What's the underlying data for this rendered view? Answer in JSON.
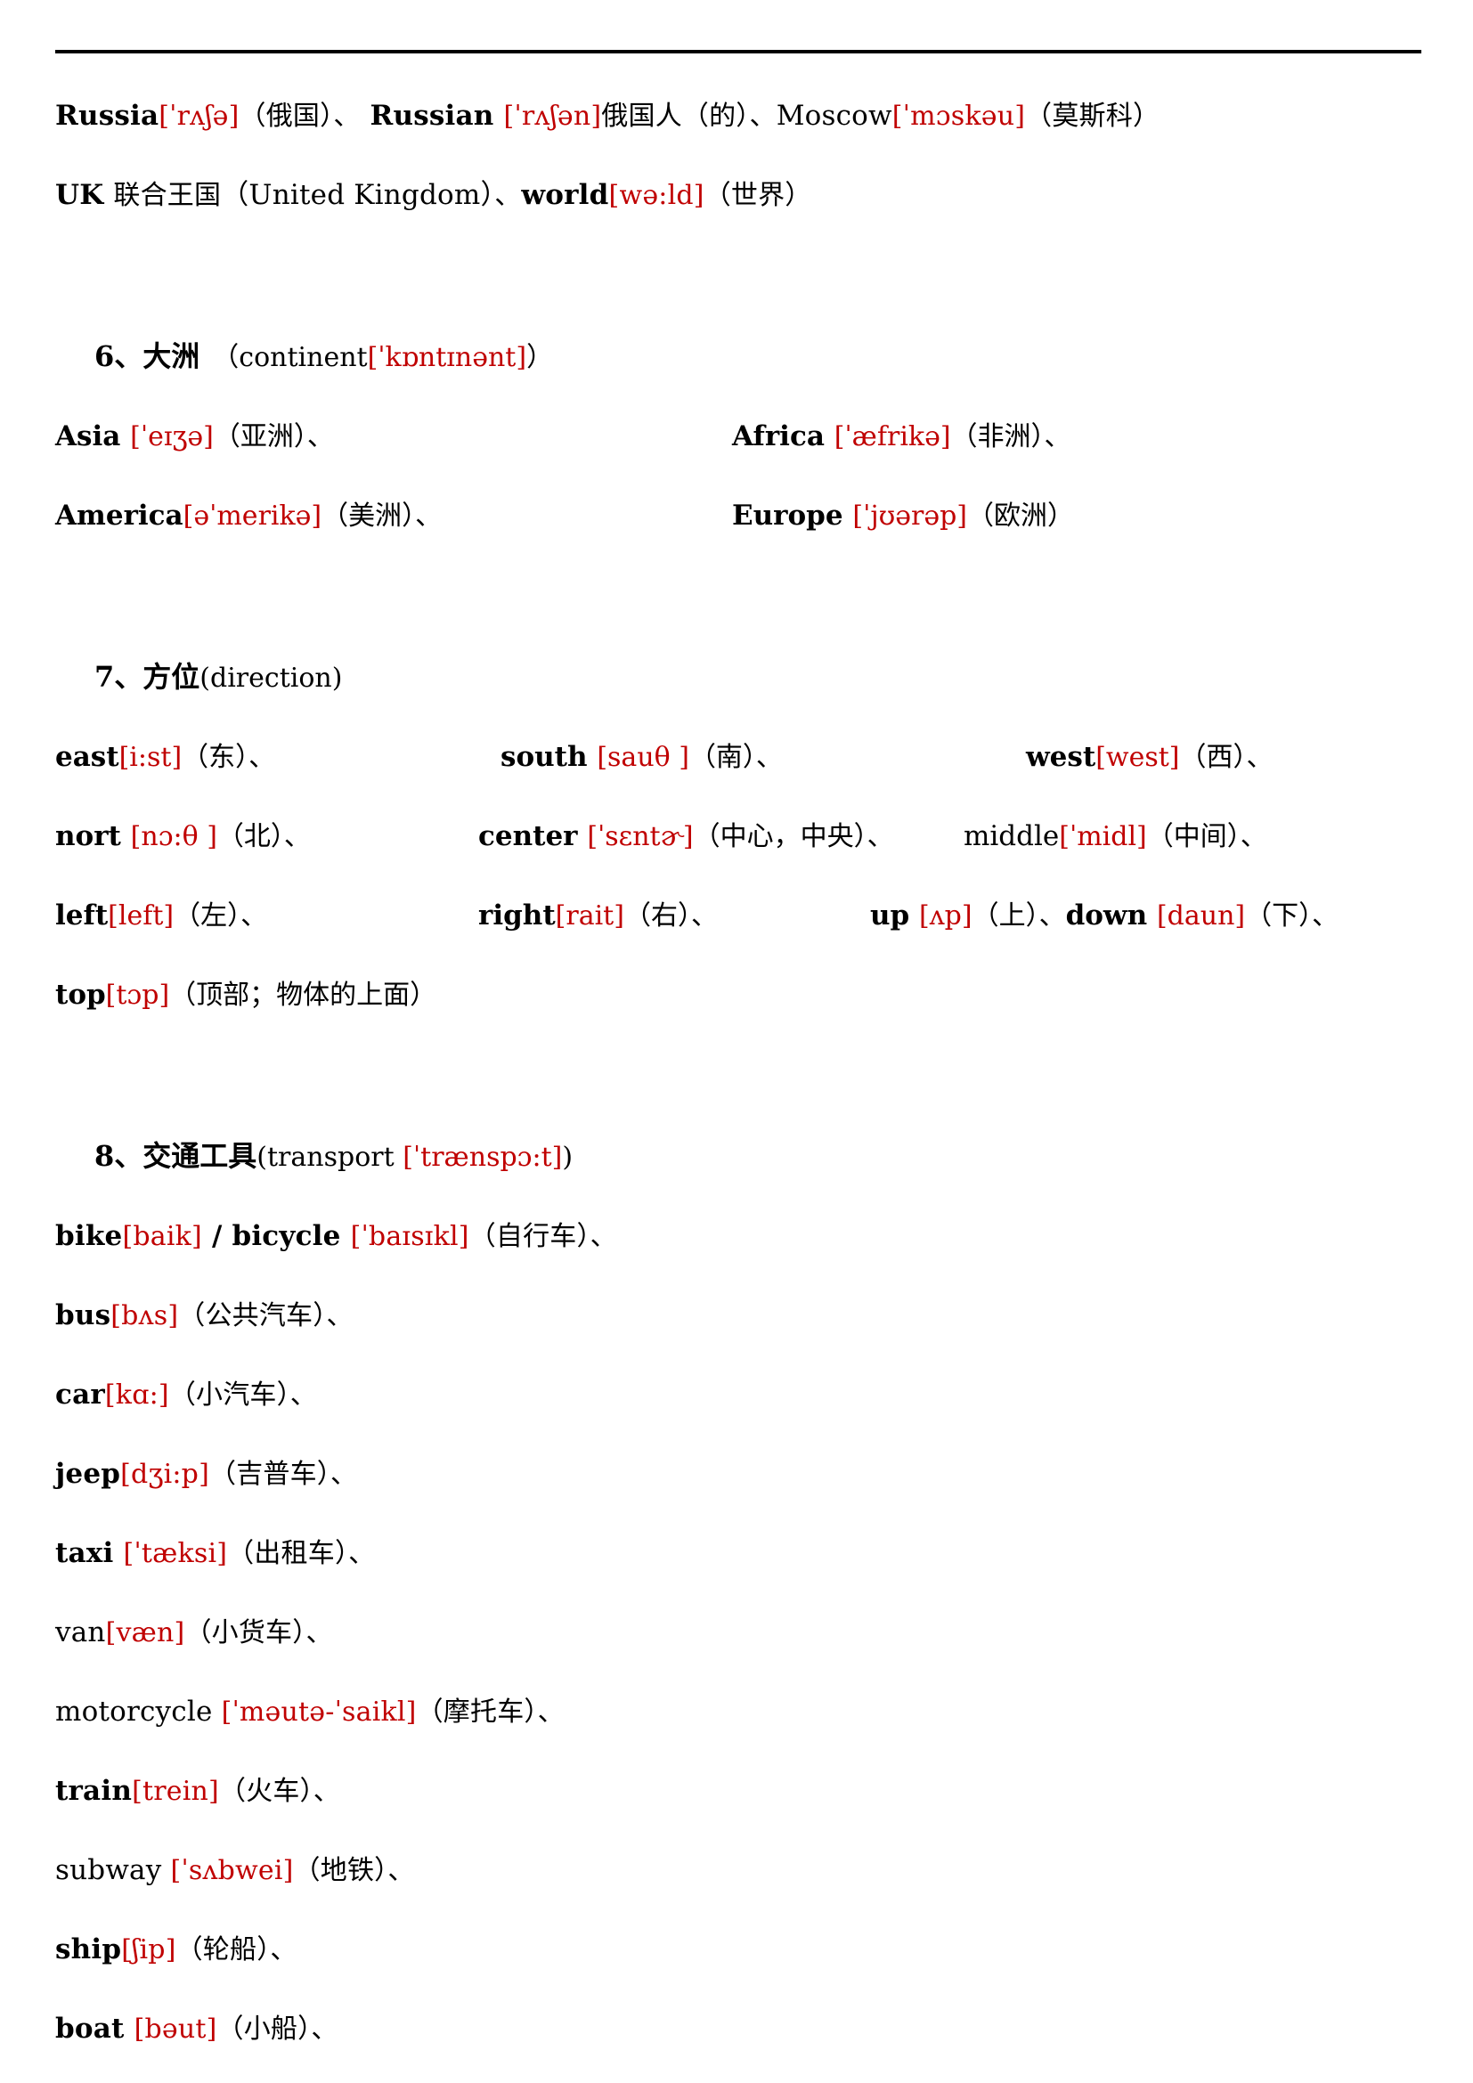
{
  "document": {
    "sections": [
      {
        "id": "countries-continued",
        "lines": [
          {
            "id": "line-russia",
            "parts": [
              {
                "type": "en",
                "text": "Russia"
              },
              {
                "type": "ipa",
                "text": "[ˈrʌʃə]"
              },
              {
                "type": "cn",
                "text": "（俄国）、"
              },
              {
                "type": "en",
                "text": " Russian "
              },
              {
                "type": "ipa",
                "text": "[ˈrʌʃən]"
              },
              {
                "type": "cn",
                "text": "俄国人（的）、"
              },
              {
                "type": "en-light",
                "text": "Moscow"
              },
              {
                "type": "ipa",
                "text": "[ˈmɔskəu]"
              },
              {
                "type": "cn",
                "text": "（莫斯科）"
              }
            ]
          },
          {
            "id": "line-uk",
            "parts": [
              {
                "type": "en",
                "text": "UK "
              },
              {
                "type": "cn",
                "text": "联合王国"
              },
              {
                "type": "en-light",
                "text": "（United Kingdom）"
              },
              {
                "type": "cn",
                "text": "、"
              },
              {
                "type": "en",
                "text": "world"
              },
              {
                "type": "ipa",
                "text": "[wə:ld]"
              },
              {
                "type": "cn",
                "text": "（世界）"
              }
            ]
          }
        ]
      },
      {
        "id": "continents",
        "heading": {
          "number": "6、",
          "title_cn": "大洲",
          "title_en": "（continent",
          "title_ipa": "[ˈkɒntɪnənt]",
          "title_close": "）"
        },
        "rows": [
          {
            "left": [
              {
                "type": "en",
                "text": "Asia "
              },
              {
                "type": "ipa",
                "text": "[ˈeɪʒə]"
              },
              {
                "type": "cn",
                "text": "（亚洲）、"
              }
            ],
            "right": [
              {
                "type": "en",
                "text": "Africa "
              },
              {
                "type": "ipa",
                "text": "[ˈæfrikə]"
              },
              {
                "type": "cn",
                "text": "（非洲）、"
              }
            ]
          },
          {
            "left": [
              {
                "type": "en",
                "text": "America"
              },
              {
                "type": "ipa",
                "text": "[əˈmerikə]"
              },
              {
                "type": "cn",
                "text": "（美洲）、"
              }
            ],
            "right": [
              {
                "type": "en",
                "text": "Europe "
              },
              {
                "type": "ipa",
                "text": "[ˈjʊərəp]"
              },
              {
                "type": "cn",
                "text": "（欧洲）"
              }
            ]
          }
        ]
      },
      {
        "id": "directions",
        "heading": {
          "number": "7、",
          "title_cn": "方位",
          "title_en": "(direction)"
        },
        "rows": [
          {
            "cells": [
              [
                {
                  "type": "en",
                  "text": "east"
                },
                {
                  "type": "ipa",
                  "text": "[i:st]"
                },
                {
                  "type": "cn",
                  "text": "（东）、"
                }
              ],
              [
                {
                  "type": "en",
                  "text": "south "
                },
                {
                  "type": "ipa",
                  "text": "[sauθ ]"
                },
                {
                  "type": "cn",
                  "text": "（南）、"
                }
              ],
              [
                {
                  "type": "en",
                  "text": "west"
                },
                {
                  "type": "ipa",
                  "text": "[west]"
                },
                {
                  "type": "cn",
                  "text": "（西）、"
                }
              ]
            ]
          },
          {
            "cells": [
              [
                {
                  "type": "en",
                  "text": "nort "
                },
                {
                  "type": "ipa",
                  "text": "[nɔ:θ ]"
                },
                {
                  "type": "cn",
                  "text": "（北）、"
                }
              ],
              [
                {
                  "type": "en",
                  "text": "center "
                },
                {
                  "type": "ipa",
                  "text": "[ˈsɛntɚ]"
                },
                {
                  "type": "cn",
                  "text": "（中心，中央）、"
                }
              ],
              [
                {
                  "type": "en-light",
                  "text": "middle"
                },
                {
                  "type": "ipa",
                  "text": "[ˈmidl]"
                },
                {
                  "type": "cn",
                  "text": "（中间）、"
                }
              ]
            ]
          },
          {
            "cells": [
              [
                {
                  "type": "en",
                  "text": "left"
                },
                {
                  "type": "ipa",
                  "text": "[left]"
                },
                {
                  "type": "cn",
                  "text": "（左）、"
                }
              ],
              [
                {
                  "type": "en",
                  "text": "right"
                },
                {
                  "type": "ipa",
                  "text": "[rait]"
                },
                {
                  "type": "cn",
                  "text": "（右）、"
                }
              ],
              [
                {
                  "type": "en",
                  "text": "up "
                },
                {
                  "type": "ipa",
                  "text": "[ʌp]"
                },
                {
                  "type": "cn",
                  "text": "（上）、"
                },
                {
                  "type": "en",
                  "text": "down "
                },
                {
                  "type": "ipa",
                  "text": "[daun]"
                },
                {
                  "type": "cn",
                  "text": "（下）、"
                }
              ]
            ]
          },
          {
            "cells": [
              [
                {
                  "type": "en",
                  "text": "top"
                },
                {
                  "type": "ipa",
                  "text": "[tɔp]"
                },
                {
                  "type": "cn",
                  "text": "（顶部；物体的上面）"
                }
              ]
            ]
          }
        ]
      },
      {
        "id": "transport",
        "heading": {
          "number": "8、",
          "title_cn": "交通工具",
          "title_en": "(transport ",
          "title_ipa": "[ˈtrænspɔ:t]",
          "title_close": ")"
        },
        "lines": [
          {
            "id": "line-bike",
            "parts": [
              {
                "type": "en",
                "text": "bike"
              },
              {
                "type": "ipa",
                "text": "[baik]"
              },
              {
                "type": "en",
                "text": " / bicycle "
              },
              {
                "type": "ipa",
                "text": "[ˈbaɪsɪkl]"
              },
              {
                "type": "cn",
                "text": "（自行车）、"
              }
            ]
          },
          {
            "id": "line-bus",
            "parts": [
              {
                "type": "en",
                "text": "bus"
              },
              {
                "type": "ipa",
                "text": "[bʌs]"
              },
              {
                "type": "cn",
                "text": "（公共汽车）、"
              }
            ]
          },
          {
            "id": "line-car",
            "parts": [
              {
                "type": "en",
                "text": "car"
              },
              {
                "type": "ipa",
                "text": "[kɑ:]"
              },
              {
                "type": "cn",
                "text": "（小汽车）、"
              }
            ]
          },
          {
            "id": "line-jeep",
            "parts": [
              {
                "type": "en",
                "text": "jeep"
              },
              {
                "type": "ipa",
                "text": "[dʒi:p]"
              },
              {
                "type": "cn",
                "text": "（吉普车）、"
              }
            ]
          },
          {
            "id": "line-taxi",
            "parts": [
              {
                "type": "en",
                "text": "taxi "
              },
              {
                "type": "ipa",
                "text": "[ˈtæksi]"
              },
              {
                "type": "cn",
                "text": "（出租车）、"
              }
            ]
          },
          {
            "id": "line-van",
            "parts": [
              {
                "type": "en-light",
                "text": "van"
              },
              {
                "type": "ipa",
                "text": "[væn]"
              },
              {
                "type": "cn",
                "text": "（小货车）、"
              }
            ]
          },
          {
            "id": "line-motorcycle",
            "parts": [
              {
                "type": "en-light",
                "text": "motorcycle "
              },
              {
                "type": "ipa",
                "text": "[ˈməutə-ˈsaikl]"
              },
              {
                "type": "cn",
                "text": "（摩托车）、"
              }
            ]
          },
          {
            "id": "line-train",
            "parts": [
              {
                "type": "en",
                "text": "train"
              },
              {
                "type": "ipa",
                "text": "[trein]"
              },
              {
                "type": "cn",
                "text": "（火车）、"
              }
            ]
          },
          {
            "id": "line-subway",
            "parts": [
              {
                "type": "en-light",
                "text": "subway "
              },
              {
                "type": "ipa",
                "text": "[ˈsʌbwei]"
              },
              {
                "type": "cn",
                "text": "（地铁）、"
              }
            ]
          },
          {
            "id": "line-ship",
            "parts": [
              {
                "type": "en",
                "text": "ship"
              },
              {
                "type": "ipa",
                "text": "[ʃip]"
              },
              {
                "type": "cn",
                "text": "（轮船）、"
              }
            ]
          },
          {
            "id": "line-boat",
            "parts": [
              {
                "type": "en",
                "text": "boat "
              },
              {
                "type": "ipa",
                "text": "[bəut]"
              },
              {
                "type": "cn",
                "text": "（小船）、"
              }
            ]
          }
        ]
      }
    ]
  },
  "colors": {
    "ipa_red": "#c00000",
    "text_black": "#000000",
    "page_background": "#ffffff"
  }
}
